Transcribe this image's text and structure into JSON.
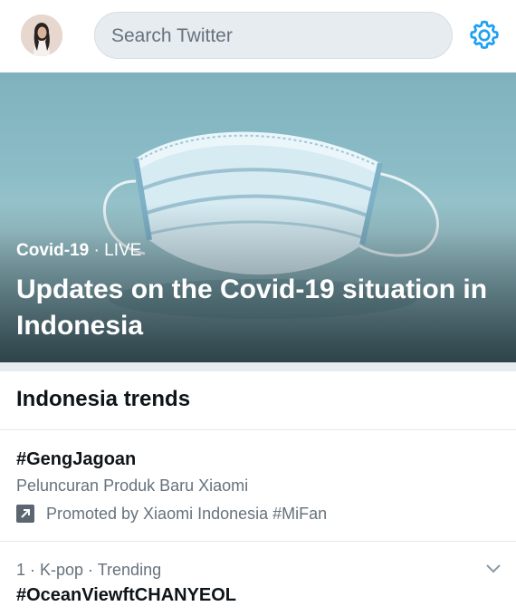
{
  "header": {
    "search_placeholder": "Search Twitter",
    "accent_color": "#1da1f2"
  },
  "hero": {
    "category": "Covid-19",
    "separator": " · ",
    "status": "LIVE",
    "title": "Updates on the Covid-19 situation in Indonesia"
  },
  "trends": {
    "section_title": "Indonesia trends",
    "promoted": {
      "name": "#GengJagoan",
      "description": "Peluncuran Produk Baru Xiaomi",
      "promoted_by": "Promoted by Xiaomi Indonesia #MiFan"
    },
    "items": [
      {
        "context": "1 · K-pop · Trending",
        "name": "#OceanViewftCHANYEOL"
      }
    ]
  },
  "icons": {
    "settings": "gear-icon",
    "promoted": "promoted-arrow-icon",
    "more": "chevron-down-icon"
  }
}
